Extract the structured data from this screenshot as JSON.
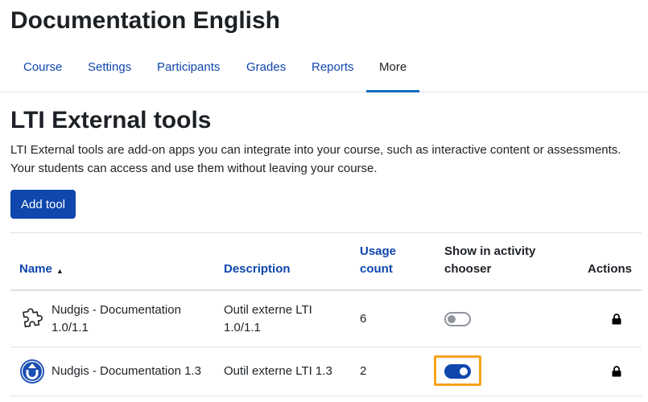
{
  "course": {
    "title": "Documentation English"
  },
  "nav": {
    "items": [
      {
        "label": "Course"
      },
      {
        "label": "Settings"
      },
      {
        "label": "Participants"
      },
      {
        "label": "Grades"
      },
      {
        "label": "Reports"
      },
      {
        "label": "More",
        "active": true
      }
    ]
  },
  "page": {
    "title": "LTI External tools",
    "intro_line1": "LTI External tools are add-on apps you can integrate into your course, such as interactive content or assessments.",
    "intro_line2": "Your students can access and use them without leaving your course.",
    "add_button": "Add tool"
  },
  "table": {
    "headers": {
      "name": "Name",
      "description": "Description",
      "usage_line1": "Usage",
      "usage_line2": "count",
      "show_line1": "Show in activity",
      "show_line2": "chooser",
      "actions": "Actions"
    },
    "sort": {
      "column": "name",
      "direction": "ascending"
    },
    "rows": [
      {
        "name_line1": "Nudgis - Documentation",
        "name_line2": "1.0/1.1",
        "desc_line1": "Outil externe LTI",
        "desc_line2": "1.0/1.1",
        "usage": "6",
        "show_in_chooser": false,
        "icon": "puzzle-piece-icon",
        "action_icon": "lock-icon"
      },
      {
        "name": "Nudgis - Documentation 1.3",
        "desc": "Outil externe LTI 1.3",
        "usage": "2",
        "show_in_chooser": true,
        "focused": true,
        "icon": "nudgis-logo-icon",
        "action_icon": "lock-icon"
      }
    ]
  },
  "colors": {
    "link": "#0f47ad",
    "primary_button": "#0f47ad",
    "focus_ring": "#f7a21b",
    "text": "#1d2125"
  }
}
